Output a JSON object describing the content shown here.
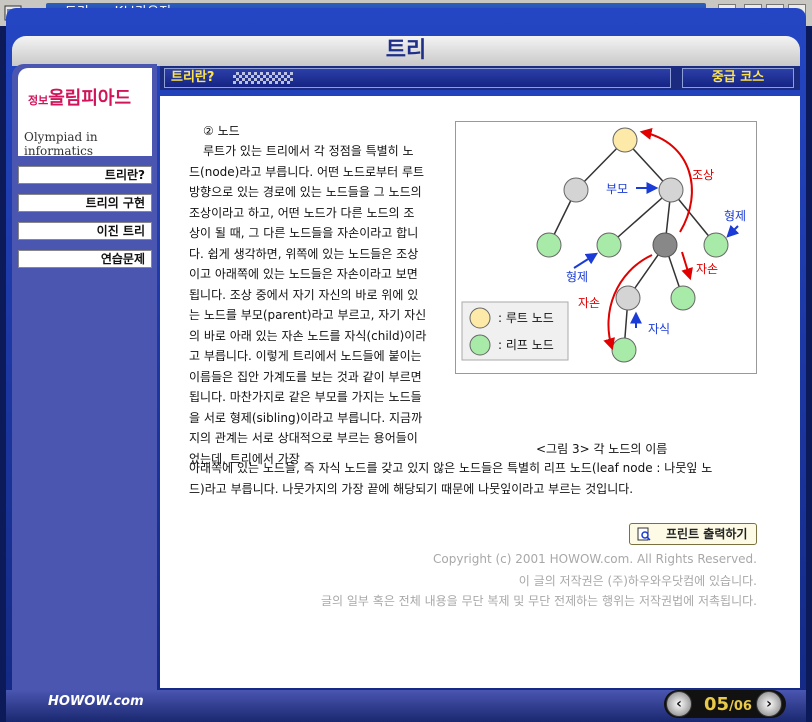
{
  "window": {
    "title": ":: 트리 :: - K브라우저",
    "btn_help": "?",
    "btn_min": "-",
    "btn_max": "□",
    "btn_close": "×"
  },
  "header": {
    "title": "트리"
  },
  "sidebar": {
    "logo_kr_small": "정보",
    "logo_kr": "올림피아드",
    "logo_en": "Olympiad in informatics",
    "items": [
      {
        "label": "트리란?"
      },
      {
        "label": "트리의 구현"
      },
      {
        "label": "이진 트리"
      },
      {
        "label": "연습문제"
      }
    ]
  },
  "section": {
    "title": "트리란?",
    "course": "중급 코스"
  },
  "content": {
    "heading": "② 노드",
    "lines": [
      "루트가 있는 트리에서 각 정점을 특별히 노",
      "드(node)라고 부릅니다. 어떤 노드로부터 루트",
      "방향으로 있는 경로에 있는 노드들을 그 노드의",
      "조상이라고 하고, 어떤 노드가 다른 노드의 조",
      "상이 될 때, 그 다른 노드들을 자손이라고 합니",
      "다. 쉽게 생각하면, 위쪽에 있는 노드들은 조상",
      "이고 아래쪽에 있는 노드들은 자손이라고 보면",
      "됩니다. 조상 중에서 자기 자신의 바로 위에 있",
      "는 노드를 부모(parent)라고 부르고, 자기 자신",
      "의 바로 아래 있는 자손 노드를 자식(child)이라",
      "고 부릅니다. 이렇게 트리에서 노드들에 붙이는",
      "이름들은 집안 가계도를 보는 것과 같이 부르면",
      "됩니다. 마찬가지로 같은 부모를 가지는 노드들",
      "을 서로 형제(sibling)이라고 부릅니다. 지금까",
      "지의 관계는 서로 상대적으로 부르는 용어들이",
      "었는데, 트리에서 가장"
    ],
    "full_line_1": "아래쪽에 있는 노드들, 즉 자식 노드를 갖고 있지 않은 노드들은 특별히 리프 노드(leaf node : 나뭇잎 노",
    "full_line_2": "드)라고 부릅니다. 나뭇가지의 가장 끝에 해당되기 때문에 나뭇잎이라고 부르는 것입니다."
  },
  "figure": {
    "caption": "<그림 3> 각 노드의 이름",
    "labels": {
      "ancestor": "조상",
      "parent": "부모",
      "sibling_right": "형제",
      "sibling_left": "형제",
      "descendant_right": "자손",
      "descendant_left": "자손",
      "child": "자식"
    },
    "legend": [
      {
        "label": ": 루트 노드",
        "color": "#fde9a8"
      },
      {
        "label": ": 리프 노드",
        "color": "#a8eaa8"
      }
    ]
  },
  "print": {
    "label": "프린트 출력하기"
  },
  "copyright": {
    "line1": "Copyright (c) 2001 HOWOW.com. All Rights Reserved.",
    "line2": "이 글의 저작권은 (주)하우와우닷컴에 있습니다.",
    "line3": "글의 일부 혹은 전체 내용을 무단 복제 및 무단 전제하는 행위는 저작권법에 저촉됩니다."
  },
  "footer": {
    "logo": "HOWOW.com",
    "page_current": "05",
    "page_sep": "/",
    "page_total": "06",
    "prev": "‹",
    "next": "›"
  },
  "colors": {
    "frame": "#142a85",
    "accent_text": "#ffe44a",
    "root_node": "#fde9a8",
    "leaf_node": "#a8eaa8",
    "inner_node": "#d4d4d4",
    "selected_node": "#888888",
    "arrow_red": "#e00000",
    "arrow_blue": "#1a3bd6"
  }
}
